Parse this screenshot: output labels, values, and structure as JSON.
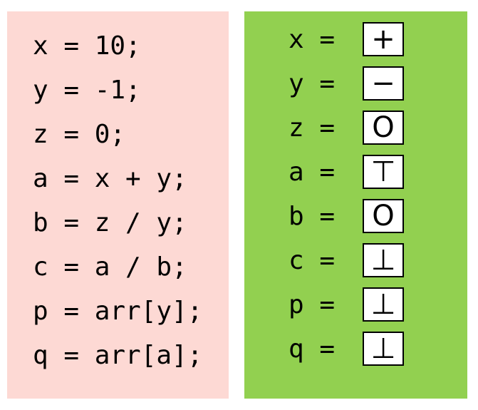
{
  "code_panel": {
    "color": "#fdd9d4",
    "lines": [
      "x = 10;",
      "y = -1;",
      "z = 0;",
      "a = x + y;",
      "b = z / y;",
      "c = a / b;",
      "p = arr[y];",
      "q = arr[a];"
    ]
  },
  "abstract_panel": {
    "color": "#92d050",
    "rows": [
      {
        "lhs": "x =",
        "value": "+"
      },
      {
        "lhs": "y =",
        "value": "−"
      },
      {
        "lhs": "z =",
        "value": "O"
      },
      {
        "lhs": "a =",
        "value": "⊤"
      },
      {
        "lhs": "b =",
        "value": "O"
      },
      {
        "lhs": "c =",
        "value": "⊥"
      },
      {
        "lhs": "p =",
        "value": "⊥"
      },
      {
        "lhs": "q =",
        "value": "⊥"
      }
    ]
  }
}
